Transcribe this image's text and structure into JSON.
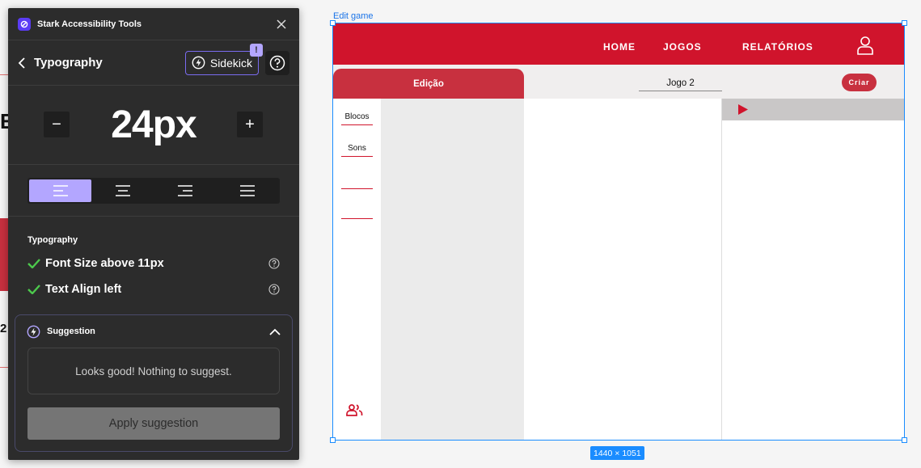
{
  "panel": {
    "app_title": "Stark Accessibility Tools",
    "nav_title": "Typography",
    "sidekick_label": "Sidekick",
    "sidekick_badge": "!",
    "font_size_value": "24px",
    "decrement_label": "−",
    "increment_label": "+",
    "alignment_options": [
      "left",
      "center",
      "right",
      "justify"
    ],
    "selected_alignment": "left",
    "section_label": "Typography",
    "checks": [
      {
        "label": "Font Size above 11px",
        "status": "pass"
      },
      {
        "label": "Text Align left",
        "status": "pass"
      }
    ],
    "suggestion": {
      "title": "Suggestion",
      "message": "Looks good! Nothing to suggest.",
      "apply_label": "Apply suggestion"
    },
    "accent_color": "#b3a6ff",
    "check_color": "#4cc84c"
  },
  "canvas": {
    "frame_label": "Edit game",
    "frame_dimensions": "1440 × 1051",
    "selection_color": "#1a8cff",
    "left_fragments": [
      "E",
      "2"
    ]
  },
  "game": {
    "nav": [
      "HOME",
      "JOGOS",
      "RELATÓRIOS"
    ],
    "tab_label": "Edição",
    "game_name": "Jogo 2",
    "create_label": "Criar",
    "sidebar_items": [
      "Blocos",
      "Sons"
    ],
    "brand_color": "#d0142c"
  }
}
